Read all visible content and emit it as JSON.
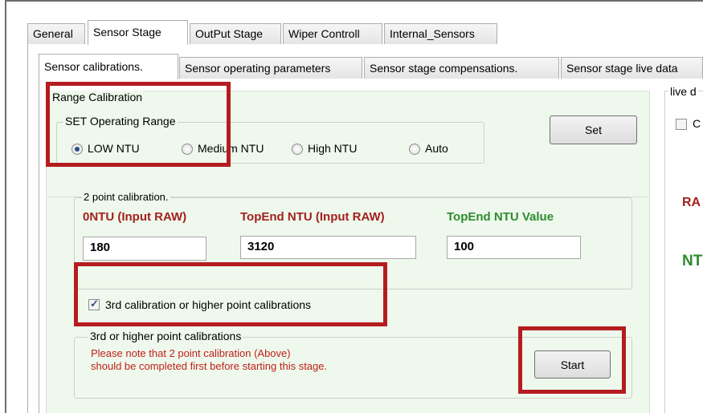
{
  "main_tabs": [
    {
      "label": "General"
    },
    {
      "label": "Sensor Stage"
    },
    {
      "label": "OutPut Stage"
    },
    {
      "label": "Wiper Controll"
    },
    {
      "label": "Internal_Sensors"
    }
  ],
  "sub_tabs": [
    {
      "label": "Sensor calibrations."
    },
    {
      "label": "Sensor operating parameters"
    },
    {
      "label": "Sensor stage compensations."
    },
    {
      "label": "Sensor stage live data"
    }
  ],
  "range_calibration": {
    "group_title": "Range Calibration",
    "operating_range_title": "SET Operating Range",
    "options": [
      {
        "label": "LOW NTU",
        "selected": true
      },
      {
        "label": "Medium NTU",
        "selected": false
      },
      {
        "label": "High NTU",
        "selected": false
      },
      {
        "label": "Auto",
        "selected": false
      }
    ],
    "set_button": "Set"
  },
  "two_point": {
    "group_title": "2 point calibration.",
    "headers": {
      "zero": "0NTU (Input RAW)",
      "top_raw": "TopEnd NTU (Input RAW)",
      "top_value": "TopEnd NTU Value"
    },
    "values": {
      "zero": "180",
      "top_raw": "3120",
      "top_value": "100"
    }
  },
  "third_point": {
    "checkbox_label": "3rd calibration or higher point calibrations",
    "checked": true,
    "group_title": "3rd or higher point calibrations",
    "note_line1": "Please note that 2 point calibration (Above)",
    "note_line2": "should be completed first before starting this stage.",
    "start_button": "Start"
  },
  "live_panel": {
    "title_fragment": "live d",
    "checkbox_fragment": "C",
    "raw_fragment": "RA",
    "ntu_fragment": "NT"
  },
  "colors": {
    "panel_bg": "#eef8ec",
    "highlight_red": "#b51c20",
    "header_red": "#a3201d",
    "header_green": "#2e8b2e",
    "note_red": "#c0201a"
  }
}
